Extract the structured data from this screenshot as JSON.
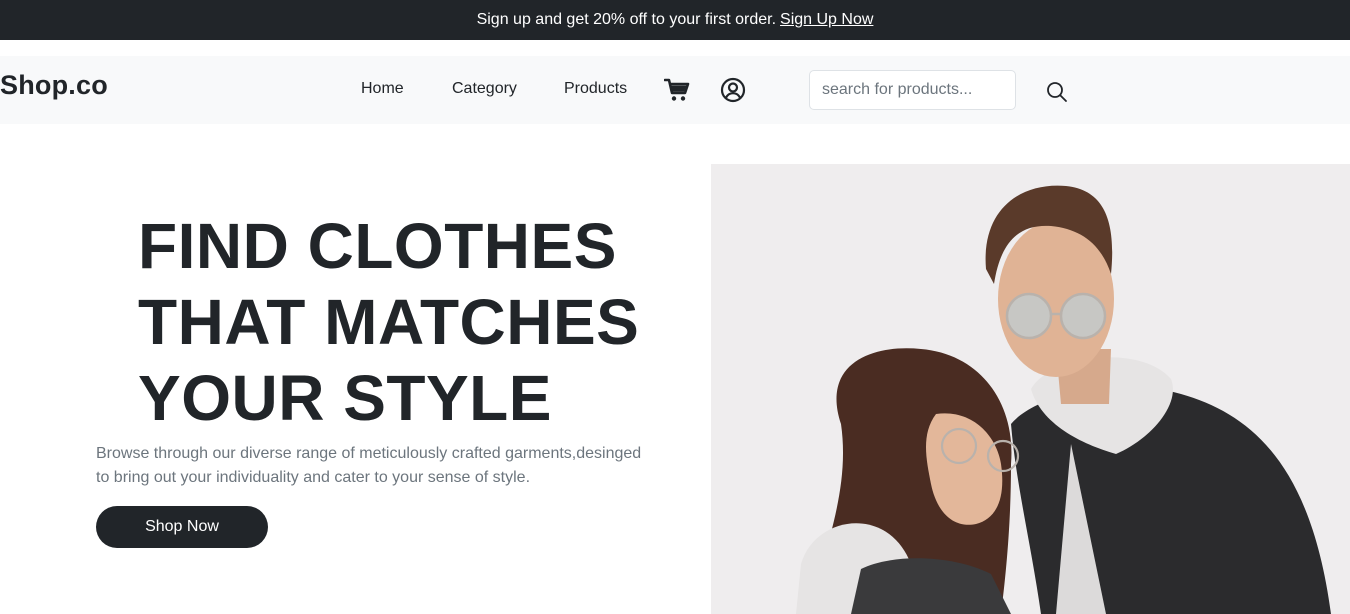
{
  "promo": {
    "text": "Sign up and get 20% off to your first order.",
    "link_label": "Sign Up Now"
  },
  "navbar": {
    "brand": "Shop.co",
    "links": [
      "Home",
      "Category",
      "Products"
    ],
    "icons": [
      "cart-icon",
      "user-circle-icon",
      "search-icon"
    ],
    "search_placeholder": "search for products..."
  },
  "hero": {
    "title_lines": [
      "FIND CLOTHES",
      "THAT MATCHES",
      "YOUR STYLE"
    ],
    "description_lines": [
      "Browse through our diverse range of meticulously crafted garments,desinged",
      "to bring out your individuality and cater to your sense of style."
    ],
    "cta_label": "Shop Now"
  },
  "colors": {
    "dark": "#212529",
    "muted_text": "#6c757d",
    "navbar_bg": "#f8f9fa",
    "image_bg": "#efedee"
  }
}
